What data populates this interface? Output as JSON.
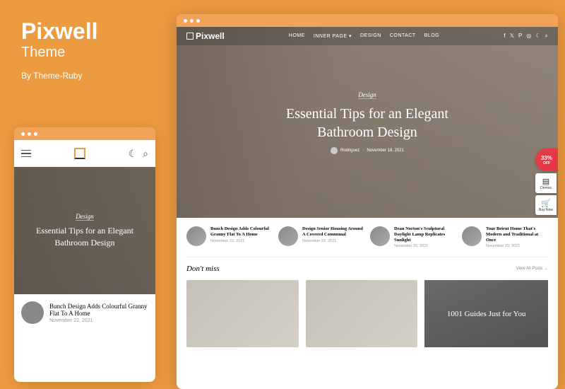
{
  "promo": {
    "title": "Pixwell",
    "subtitle": "Theme",
    "author": "By Theme-Ruby"
  },
  "nav": {
    "logo": "Pixwell",
    "items": [
      "HOME",
      "INNER PAGE ▾",
      "DESIGN",
      "CONTACT",
      "BLOG"
    ]
  },
  "hero": {
    "category": "Design",
    "title_line1": "Essential Tips for an Elegant",
    "title_line2": "Bathroom Design",
    "author": "Rodriguez",
    "date": "November 18, 2021"
  },
  "posts": [
    {
      "title": "Bunch Design Adds Colourful Granny Flat To A Home",
      "date": "November 22, 2021"
    },
    {
      "title": "Design Senior Housing Around A Covered Communal",
      "date": "November 22, 2021"
    },
    {
      "title": "Dean Norton's Sculptural Daylight Lamp Replicates Sunlight",
      "date": "November 20, 2021"
    },
    {
      "title": "Tour Beirut Home That's Modern and Traditional at Once",
      "date": "November 20, 2021"
    }
  ],
  "section": {
    "title": "Don't miss",
    "viewall": "View All Posts →"
  },
  "sidebar_card": "1001 Guides Just for You",
  "badges": {
    "discount": "33%",
    "discount_sub": "OFF",
    "demos": "Demos",
    "buy": "Buy Now"
  },
  "mobile": {
    "post_title": "Bunch Design Adds Colourful Granny Flat To A Home",
    "post_date": "November 22, 2021"
  }
}
